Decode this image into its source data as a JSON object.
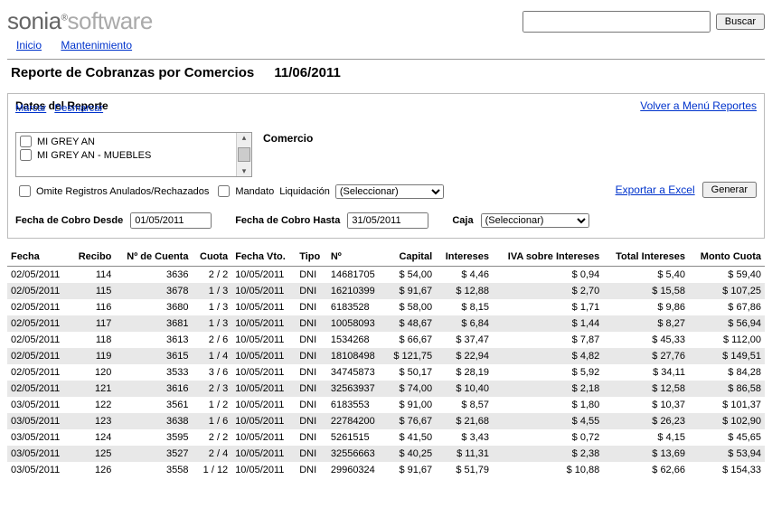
{
  "brand": {
    "part1": "sonia",
    "reg": "®",
    "part2": "software"
  },
  "search": {
    "button": "Buscar"
  },
  "nav": {
    "home": "Inicio",
    "maint": "Mantenimiento"
  },
  "page": {
    "title": "Reporte de Cobranzas por Comercios",
    "date": "11/06/2011"
  },
  "panel": {
    "title": "Datos del Reporte",
    "back_link": "Volver a Menú Reportes",
    "marcar": "Marcar",
    "desmarcar": "Desmarcar",
    "listbox": [
      "MI GREY AN",
      "MI GREY AN - MUEBLES"
    ],
    "comercio_label": "Comercio",
    "omite_label": "Omite Registros Anulados/Rechazados",
    "mandato_label": "Mandato",
    "liquidacion_label": "Liquidación",
    "liquidacion_placeholder": "(Seleccionar)",
    "export_link": "Exportar a Excel",
    "generate_button": "Generar",
    "fecha_desde_label": "Fecha de Cobro Desde",
    "fecha_desde_value": "01/05/2011",
    "fecha_hasta_label": "Fecha de Cobro Hasta",
    "fecha_hasta_value": "31/05/2011",
    "caja_label": "Caja",
    "caja_placeholder": "(Seleccionar)"
  },
  "columns": [
    "Fecha",
    "Recibo",
    "Nº de Cuenta",
    "Cuota",
    "Fecha Vto.",
    "Tipo",
    "Nº",
    "Capital",
    "Intereses",
    "IVA sobre Intereses",
    "Total Intereses",
    "Monto Cuota"
  ],
  "rows": [
    {
      "fecha": "02/05/2011",
      "recibo": "114",
      "cuenta": "3636",
      "cuota": "2 / 2",
      "vto": "10/05/2011",
      "tipo": "DNI",
      "nro": "14681705",
      "capital": "$ 54,00",
      "intereses": "$ 4,46",
      "iva": "$ 0,94",
      "totint": "$ 5,40",
      "monto": "$ 59,40"
    },
    {
      "fecha": "02/05/2011",
      "recibo": "115",
      "cuenta": "3678",
      "cuota": "1 / 3",
      "vto": "10/05/2011",
      "tipo": "DNI",
      "nro": "16210399",
      "capital": "$ 91,67",
      "intereses": "$ 12,88",
      "iva": "$ 2,70",
      "totint": "$ 15,58",
      "monto": "$ 107,25"
    },
    {
      "fecha": "02/05/2011",
      "recibo": "116",
      "cuenta": "3680",
      "cuota": "1 / 3",
      "vto": "10/05/2011",
      "tipo": "DNI",
      "nro": "6183528",
      "capital": "$ 58,00",
      "intereses": "$ 8,15",
      "iva": "$ 1,71",
      "totint": "$ 9,86",
      "monto": "$ 67,86"
    },
    {
      "fecha": "02/05/2011",
      "recibo": "117",
      "cuenta": "3681",
      "cuota": "1 / 3",
      "vto": "10/05/2011",
      "tipo": "DNI",
      "nro": "10058093",
      "capital": "$ 48,67",
      "intereses": "$ 6,84",
      "iva": "$ 1,44",
      "totint": "$ 8,27",
      "monto": "$ 56,94"
    },
    {
      "fecha": "02/05/2011",
      "recibo": "118",
      "cuenta": "3613",
      "cuota": "2 / 6",
      "vto": "10/05/2011",
      "tipo": "DNI",
      "nro": "1534268",
      "capital": "$ 66,67",
      "intereses": "$ 37,47",
      "iva": "$ 7,87",
      "totint": "$ 45,33",
      "monto": "$ 112,00"
    },
    {
      "fecha": "02/05/2011",
      "recibo": "119",
      "cuenta": "3615",
      "cuota": "1 / 4",
      "vto": "10/05/2011",
      "tipo": "DNI",
      "nro": "18108498",
      "capital": "$ 121,75",
      "intereses": "$ 22,94",
      "iva": "$ 4,82",
      "totint": "$ 27,76",
      "monto": "$ 149,51"
    },
    {
      "fecha": "02/05/2011",
      "recibo": "120",
      "cuenta": "3533",
      "cuota": "3 / 6",
      "vto": "10/05/2011",
      "tipo": "DNI",
      "nro": "34745873",
      "capital": "$ 50,17",
      "intereses": "$ 28,19",
      "iva": "$ 5,92",
      "totint": "$ 34,11",
      "monto": "$ 84,28"
    },
    {
      "fecha": "02/05/2011",
      "recibo": "121",
      "cuenta": "3616",
      "cuota": "2 / 3",
      "vto": "10/05/2011",
      "tipo": "DNI",
      "nro": "32563937",
      "capital": "$ 74,00",
      "intereses": "$ 10,40",
      "iva": "$ 2,18",
      "totint": "$ 12,58",
      "monto": "$ 86,58"
    },
    {
      "fecha": "03/05/2011",
      "recibo": "122",
      "cuenta": "3561",
      "cuota": "1 / 2",
      "vto": "10/05/2011",
      "tipo": "DNI",
      "nro": "6183553",
      "capital": "$ 91,00",
      "intereses": "$ 8,57",
      "iva": "$ 1,80",
      "totint": "$ 10,37",
      "monto": "$ 101,37"
    },
    {
      "fecha": "03/05/2011",
      "recibo": "123",
      "cuenta": "3638",
      "cuota": "1 / 6",
      "vto": "10/05/2011",
      "tipo": "DNI",
      "nro": "22784200",
      "capital": "$ 76,67",
      "intereses": "$ 21,68",
      "iva": "$ 4,55",
      "totint": "$ 26,23",
      "monto": "$ 102,90"
    },
    {
      "fecha": "03/05/2011",
      "recibo": "124",
      "cuenta": "3595",
      "cuota": "2 / 2",
      "vto": "10/05/2011",
      "tipo": "DNI",
      "nro": "5261515",
      "capital": "$ 41,50",
      "intereses": "$ 3,43",
      "iva": "$ 0,72",
      "totint": "$ 4,15",
      "monto": "$ 45,65"
    },
    {
      "fecha": "03/05/2011",
      "recibo": "125",
      "cuenta": "3527",
      "cuota": "2 / 4",
      "vto": "10/05/2011",
      "tipo": "DNI",
      "nro": "32556663",
      "capital": "$ 40,25",
      "intereses": "$ 11,31",
      "iva": "$ 2,38",
      "totint": "$ 13,69",
      "monto": "$ 53,94"
    },
    {
      "fecha": "03/05/2011",
      "recibo": "126",
      "cuenta": "3558",
      "cuota": "1 / 12",
      "vto": "10/05/2011",
      "tipo": "DNI",
      "nro": "29960324",
      "capital": "$ 91,67",
      "intereses": "$ 51,79",
      "iva": "$ 10,88",
      "totint": "$ 62,66",
      "monto": "$ 154,33"
    }
  ]
}
